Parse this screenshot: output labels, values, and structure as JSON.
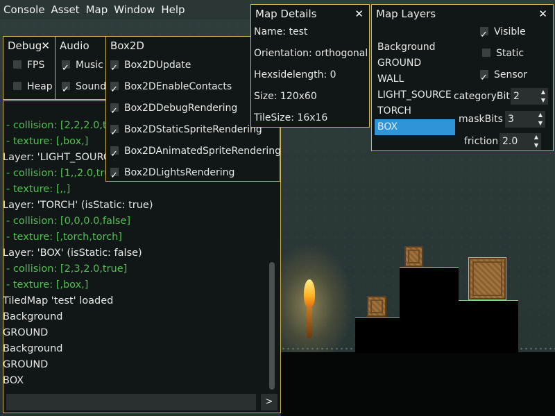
{
  "menubar": {
    "items": [
      "Console",
      "Asset",
      "Map",
      "Window",
      "Help"
    ]
  },
  "debug": {
    "title": "Debug",
    "close": "✕",
    "items": [
      {
        "label": "FPS",
        "checked": false
      },
      {
        "label": "Heap",
        "checked": false
      }
    ]
  },
  "audio": {
    "title": "Audio",
    "items": [
      {
        "label": "Music",
        "checked": true
      },
      {
        "label": "Sound",
        "checked": true
      }
    ]
  },
  "box2d": {
    "title": "Box2D",
    "items": [
      {
        "label": "Box2DUpdate",
        "checked": true
      },
      {
        "label": "Box2DEnableContacts",
        "checked": true
      },
      {
        "label": "Box2DDebugRendering",
        "checked": true
      },
      {
        "label": "Box2DStaticSpriteRendering",
        "checked": true
      },
      {
        "label": "Box2DAnimatedSpriteRendering",
        "checked": true
      },
      {
        "label": "Box2DLightsRendering",
        "checked": true
      }
    ]
  },
  "console": {
    "lines": [
      {
        "text": "- collision: [2,2,2.0,tr",
        "green": true
      },
      {
        "text": "- texture: [,box,]",
        "green": true
      },
      {
        "text": "Layer: 'LIGHT_SOURC",
        "green": false
      },
      {
        "text": "- collision: [1,,2.0,tru",
        "green": true
      },
      {
        "text": "- texture: [,,]",
        "green": true
      },
      {
        "text": "Layer: 'TORCH' (isStatic: true)",
        "green": false
      },
      {
        "text": "- collision: [0,0,0.0,false]",
        "green": true
      },
      {
        "text": "- texture: [,torch,torch]",
        "green": true
      },
      {
        "text": "Layer: 'BOX' (isStatic: false)",
        "green": false
      },
      {
        "text": "- collision: [2,3,2.0,true]",
        "green": true
      },
      {
        "text": "- texture: [,box,]",
        "green": true
      },
      {
        "text": "TiledMap 'test' loaded",
        "green": false
      },
      {
        "text": "Background",
        "green": false
      },
      {
        "text": "GROUND",
        "green": false
      },
      {
        "text": "Background",
        "green": false
      },
      {
        "text": "GROUND",
        "green": false
      },
      {
        "text": "BOX",
        "green": false
      }
    ],
    "send_label": ">",
    "input_value": ""
  },
  "map_details": {
    "title": "Map Details",
    "close": "✕",
    "lines": [
      "Name: test",
      "Orientation: orthogonal",
      "Hexsidelength: 0",
      "Size: 120x60",
      "TileSize: 16x16"
    ]
  },
  "map_layers": {
    "title": "Map Layers",
    "close": "✕",
    "layers": [
      "Background",
      "GROUND",
      "WALL",
      "LIGHT_SOURCE",
      "TORCH",
      "BOX"
    ],
    "selected": "BOX",
    "visible_label": "Visible",
    "static_label": "Static",
    "sensor_label": "Sensor",
    "visible": true,
    "static": false,
    "sensor": true,
    "category_label": "categoryBit",
    "category_value": "2",
    "mask_label": "maskBits",
    "mask_value": "3",
    "friction_label": "friction",
    "friction_value": "2.0"
  },
  "colors": {
    "panel_border": "#d2b34a",
    "console_green": "#4ec24e",
    "selection": "#2e96d8"
  }
}
